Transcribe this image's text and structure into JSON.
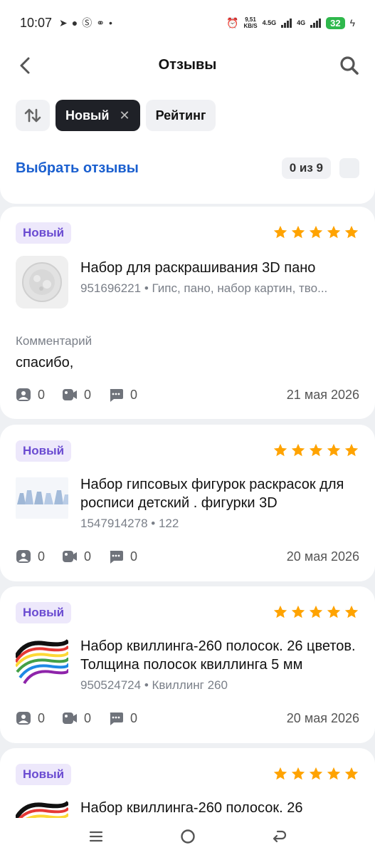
{
  "status": {
    "time": "10:07",
    "netspeed_value": "9,51",
    "netspeed_unit": "KB/S",
    "signal1": "4.5G",
    "signal2": "4G",
    "battery": "32"
  },
  "header": {
    "title": "Отзывы"
  },
  "filters": {
    "active_chip": "Новый",
    "rating_chip": "Рейтинг"
  },
  "selection": {
    "link": "Выбрать отзывы",
    "counter": "0 из 9"
  },
  "colors": {
    "accent": "#1a5fcf",
    "badge_bg": "#ede8fb",
    "badge_text": "#6a4bd1",
    "star": "#ffa300",
    "active_chip": "#1f2127"
  },
  "reviews": [
    {
      "badge": "Новый",
      "rating": 5,
      "title": "Набор для раскрашивания 3D пано",
      "meta": "951696221 • Гипс, пано, набор картин, тво...",
      "comment_label": "Комментарий",
      "comment": "спасибо,",
      "photos": "0",
      "videos": "0",
      "replies": "0",
      "date": "21 мая 2026"
    },
    {
      "badge": "Новый",
      "rating": 5,
      "title": "Набор гипсовых фигурок раскрасок для росписи детский . фигурки 3D",
      "meta": "1547914278 • 122",
      "photos": "0",
      "videos": "0",
      "replies": "0",
      "date": "20 мая 2026"
    },
    {
      "badge": "Новый",
      "rating": 5,
      "title": "Набор квиллинга-260 полосок. 26 цветов. Толщина полосок квиллинга 5 мм",
      "meta": "950524724 • Квиллинг 260",
      "photos": "0",
      "videos": "0",
      "replies": "0",
      "date": "20 мая 2026"
    },
    {
      "badge": "Новый",
      "rating": 5,
      "title": "Набор квиллинга-260 полосок. 26"
    }
  ]
}
